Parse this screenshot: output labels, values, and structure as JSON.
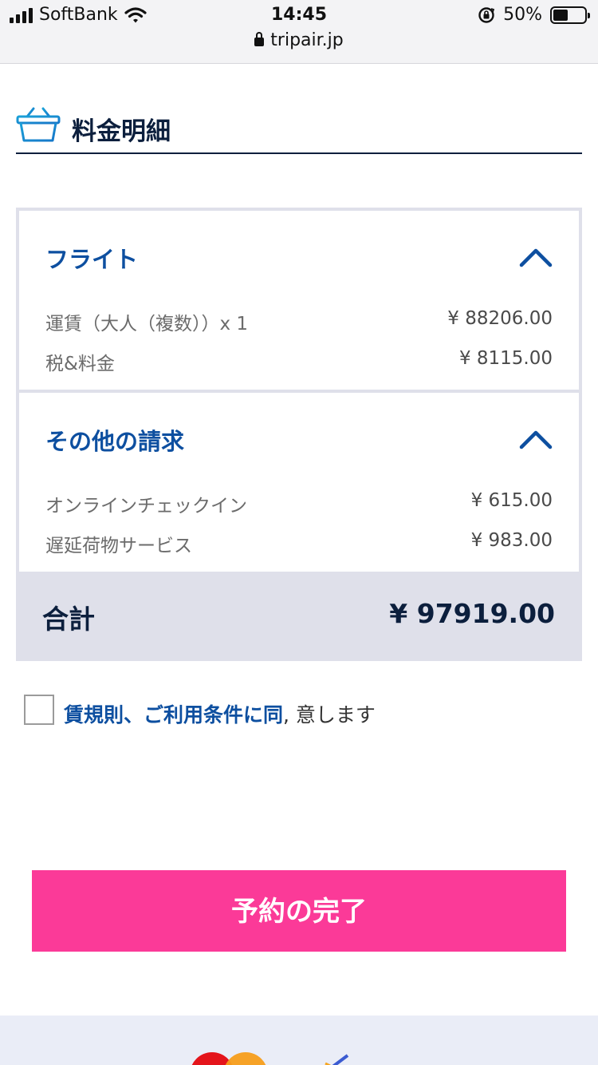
{
  "status_bar": {
    "carrier": "SoftBank",
    "time": "14:45",
    "battery": "50%",
    "url": "tripair.jp"
  },
  "section": {
    "title": "料金明細"
  },
  "flight": {
    "title": "フライト",
    "rows": [
      {
        "label": "運賃（大人（複数））x 1",
        "value": "¥ 88206.00"
      },
      {
        "label": "税&料金",
        "value": "¥ 8115.00"
      }
    ]
  },
  "other": {
    "title": "その他の請求",
    "rows": [
      {
        "label": "オンラインチェックイン",
        "value": "¥ 615.00"
      },
      {
        "label": "遅延荷物サービス",
        "value": "¥ 983.00"
      }
    ]
  },
  "total": {
    "label": "合計",
    "value": "¥ 97919.00"
  },
  "agreement": {
    "link_text": "賃規則、ご利用条件に同",
    "rest_text": ", 意します"
  },
  "cta": {
    "label": "予約の完了"
  },
  "colors": {
    "accent_blue": "#0d4fa0",
    "navy": "#0c1f3d",
    "cta_pink": "#fb3a98",
    "card_bg": "#dfe0ea"
  }
}
